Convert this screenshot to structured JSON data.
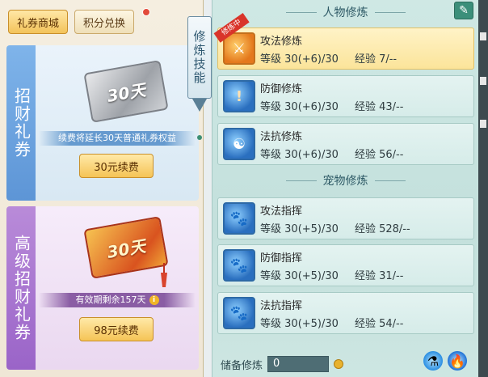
{
  "shop": {
    "tabs": [
      {
        "label": "礼券商城",
        "active": true
      },
      {
        "label": "积分兑换",
        "active": false
      }
    ],
    "cards": [
      {
        "side_title": "招财礼券",
        "ticket_text": "30天",
        "info": "续费将延长30天普通礼券权益",
        "button": "30元续费"
      },
      {
        "side_title": "高级招财礼券",
        "ticket_text": "30天",
        "info": "有效期剩余157天",
        "button": "98元续费"
      }
    ]
  },
  "side_tab": {
    "label": "修炼技能"
  },
  "cultivation": {
    "person_header": "人物修炼",
    "pet_header": "宠物修炼",
    "level_label": "等级",
    "exp_label": "经验",
    "person_skills": [
      {
        "name": "攻法修炼",
        "level": "30(+6)/30",
        "exp": "7/--",
        "selected": true,
        "ribbon": "修炼中",
        "icon": "sword-shield-icon"
      },
      {
        "name": "防御修炼",
        "level": "30(+6)/30",
        "exp": "43/--",
        "selected": false,
        "icon": "defense-shield-icon"
      },
      {
        "name": "法抗修炼",
        "level": "30(+6)/30",
        "exp": "56/--",
        "selected": false,
        "icon": "magic-resist-shield-icon"
      }
    ],
    "pet_skills": [
      {
        "name": "攻法指挥",
        "level": "30(+5)/30",
        "exp": "528/--",
        "icon": "paw-attack-icon"
      },
      {
        "name": "防御指挥",
        "level": "30(+5)/30",
        "exp": "31/--",
        "icon": "paw-defense-icon"
      },
      {
        "name": "法抗指挥",
        "level": "30(+5)/30",
        "exp": "54/--",
        "icon": "paw-resist-icon"
      }
    ],
    "reserve": {
      "label": "储备修炼",
      "value": "0"
    }
  }
}
